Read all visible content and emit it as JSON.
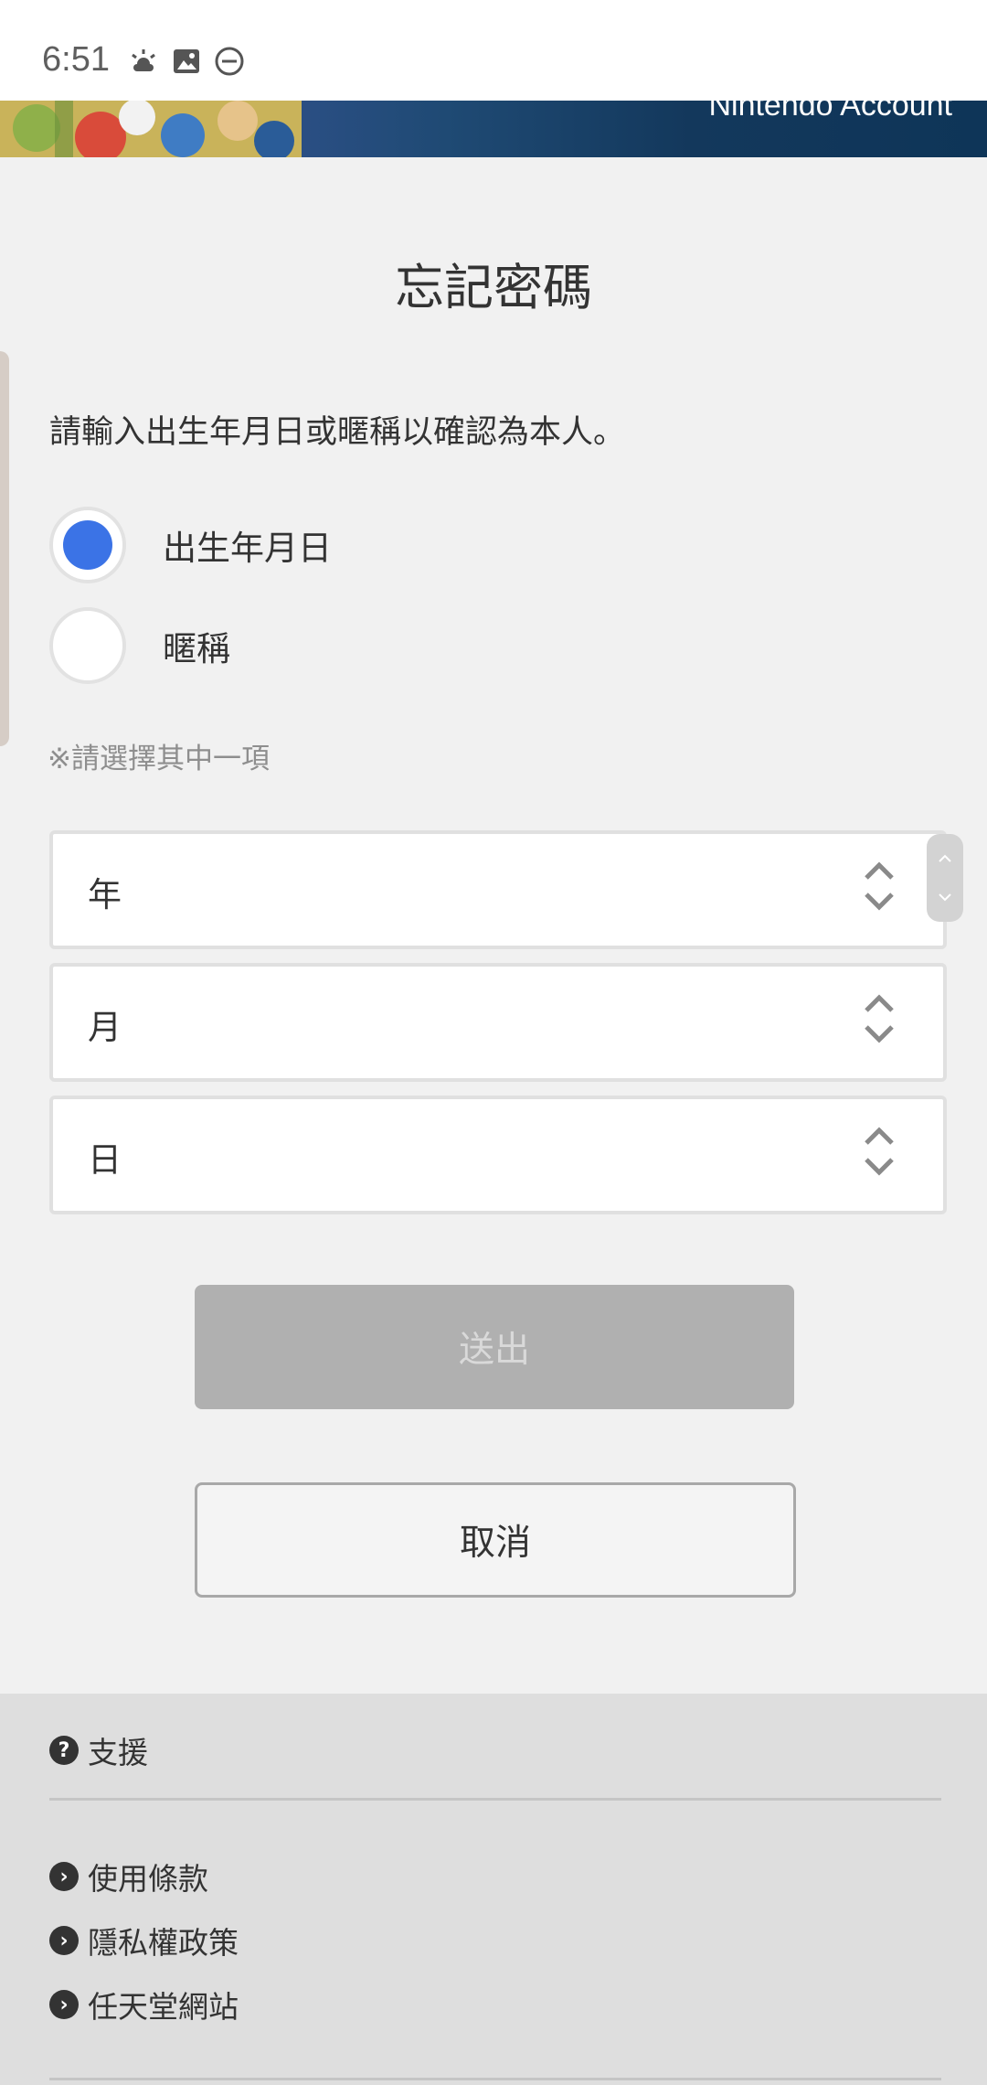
{
  "status_bar": {
    "time": "6:51",
    "icons": [
      "weather-sunrise-icon",
      "image-icon",
      "do-not-disturb-icon"
    ]
  },
  "banner": {
    "text": "Nintendo Account"
  },
  "page": {
    "title": "忘記密碼",
    "instruction": "請輸入出生年月日或暱稱以確認為本人。",
    "options": [
      {
        "label": "出生年月日",
        "selected": true
      },
      {
        "label": "暱稱",
        "selected": false
      }
    ],
    "note": "※請選擇其中一項",
    "selects": {
      "year": "年",
      "month": "月",
      "day": "日"
    },
    "submit_label": "送出",
    "cancel_label": "取消"
  },
  "footer": {
    "support": "支援",
    "links": [
      "使用條款",
      "隱私權政策",
      "任天堂網站"
    ]
  },
  "colors": {
    "accent": "#3b73e6",
    "banner": "#13385c",
    "disabled_button": "#b0b0b0"
  }
}
